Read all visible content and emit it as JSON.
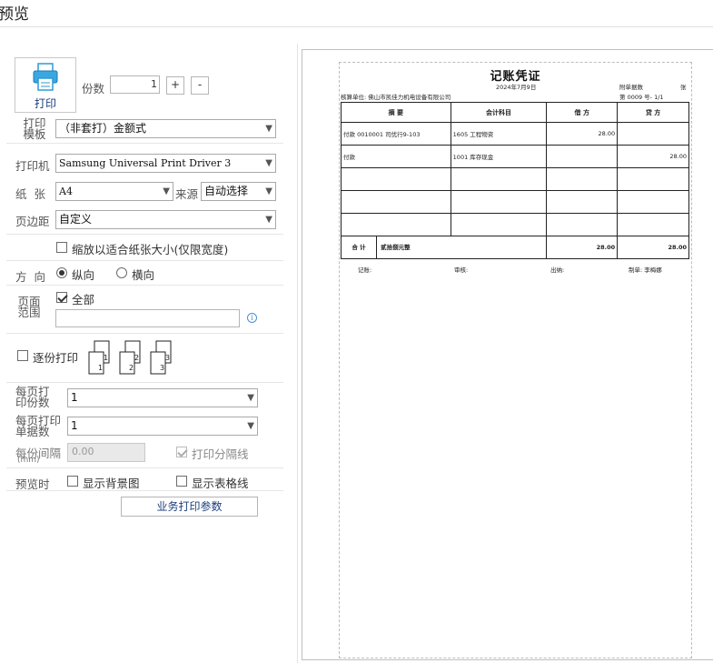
{
  "window": {
    "title": "预览"
  },
  "left": {
    "print_button": "打印",
    "copies_label": "份数",
    "copies_value": "1",
    "plus": "+",
    "minus": "-",
    "template_label": "打印\n模板",
    "template_value": "（非套打）金额式",
    "printer_label": "打印机",
    "printer_value": "Samsung Universal Print Driver 3",
    "paper_label": "纸  张",
    "paper_value": "A4",
    "source_label": "来源",
    "source_value": "自动选择",
    "margin_label": "页边距",
    "margin_value": "自定义",
    "fit_label": "缩放以适合纸张大小(仅限宽度)",
    "orientation_label": "方  向",
    "portrait_label": "纵向",
    "landscape_label": "横向",
    "range_label": "页面\n范围",
    "all_label": "全部",
    "collate_label": "逐份打印",
    "collate_pages": [
      "1",
      "2",
      "3"
    ],
    "per_page_copies_label": "每页打\n印份数",
    "per_page_copies_value": "1",
    "per_page_docs_label": "每页打印\n单据数",
    "per_page_docs_value": "1",
    "gap_label": "每份间隔",
    "gap_unit": "(mm)",
    "gap_value": "0.00",
    "separator_label": "打印分隔线",
    "preview_label": "预览时",
    "show_bg_label": "显示背景图",
    "show_grid_label": "显示表格线",
    "biz_params_button": "业务打印参数"
  },
  "voucher": {
    "title": "记账凭证",
    "date": "2024年7月9日",
    "attachments_label": "附单据数",
    "attachments_unit": "张",
    "company_label": "核算单位: 佛山市凯佳力机电设备有限公司",
    "number_label": "第  0009  号-  1/1",
    "headers": [
      "摘 要",
      "会计科目",
      "借 方",
      "贷 方"
    ],
    "rows": [
      {
        "summary": "付款 0010001 司优行9-103",
        "account": "1605 工程物资",
        "debit": "28.00",
        "credit": ""
      },
      {
        "summary": "付款",
        "account": "1001 库存现金",
        "debit": "",
        "credit": "28.00"
      },
      {
        "summary": "",
        "account": "",
        "debit": "",
        "credit": ""
      },
      {
        "summary": "",
        "account": "",
        "debit": "",
        "credit": ""
      },
      {
        "summary": "",
        "account": "",
        "debit": "",
        "credit": ""
      }
    ],
    "total_label": "合 计",
    "total_words": "贰拾捌元整",
    "total_debit": "28.00",
    "total_credit": "28.00",
    "footer": {
      "bookkeeper": "记账:",
      "reviewer": "审核:",
      "cashier": "出纳:",
      "maker": "制单: 李梅娜"
    }
  }
}
